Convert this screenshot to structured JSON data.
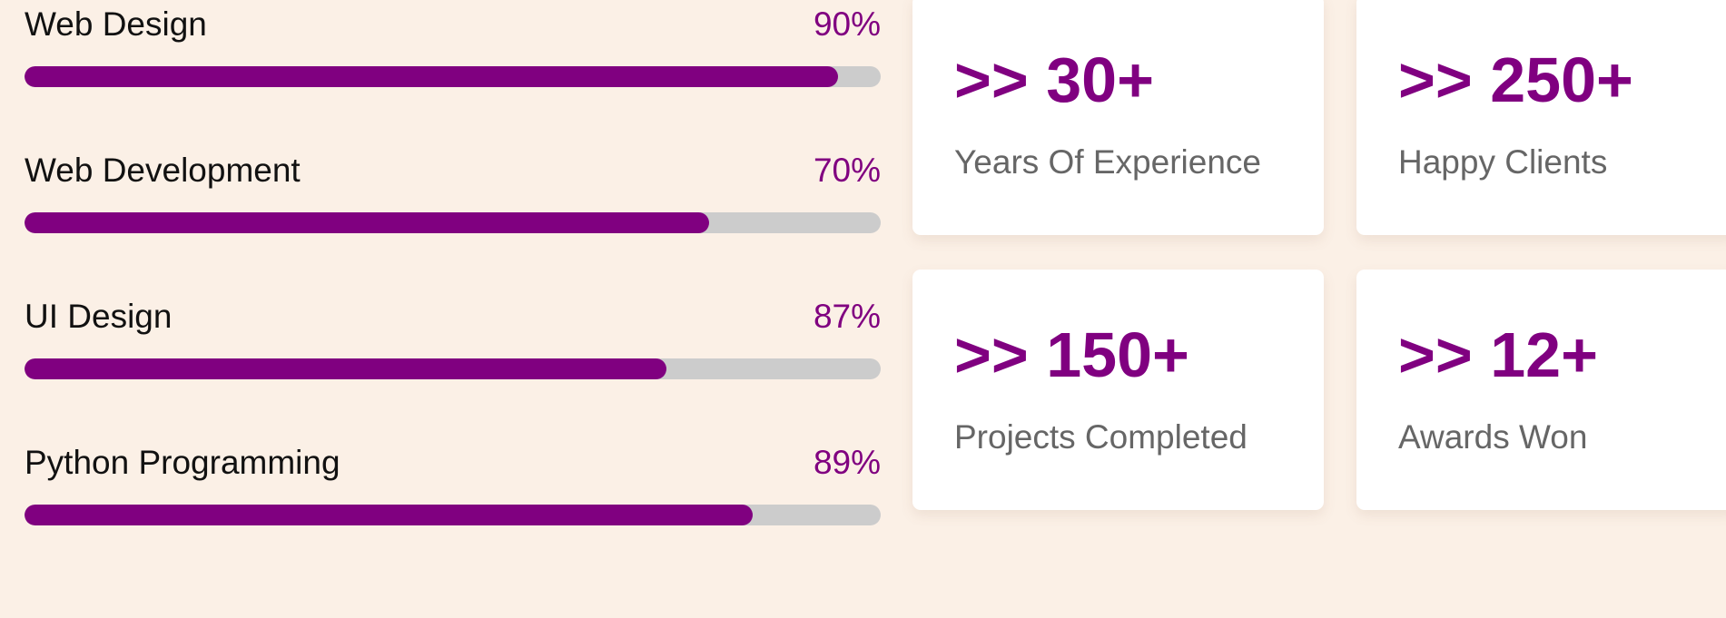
{
  "skills": [
    {
      "name": "Web Design",
      "percent_label": "90%",
      "fill_fraction": 0.95
    },
    {
      "name": "Web Development",
      "percent_label": "70%",
      "fill_fraction": 0.8
    },
    {
      "name": "UI Design",
      "percent_label": "87%",
      "fill_fraction": 0.75
    },
    {
      "name": "Python Programming",
      "percent_label": "89%",
      "fill_fraction": 0.85
    }
  ],
  "stats": [
    {
      "value": ">> 30+",
      "label": "Years Of Experience"
    },
    {
      "value": ">> 250+",
      "label": "Happy Clients"
    },
    {
      "value": ">> 150+",
      "label": "Projects Completed"
    },
    {
      "value": ">> 12+",
      "label": "Awards Won"
    }
  ],
  "colors": {
    "accent": "#800080",
    "page_background": "#fbf0e6",
    "track": "#cccccc",
    "card_background": "#ffffff",
    "label_gray": "#666666"
  }
}
